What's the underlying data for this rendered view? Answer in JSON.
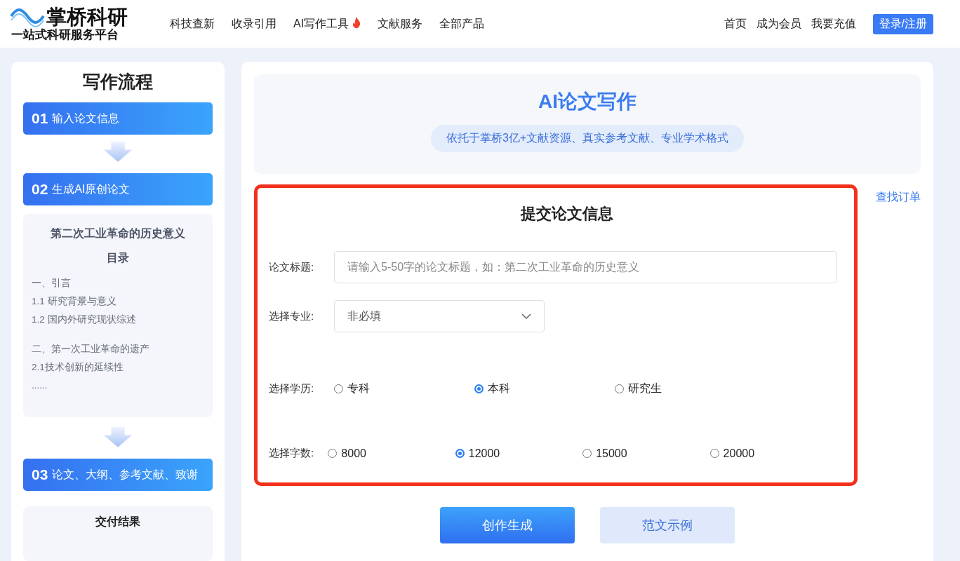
{
  "header": {
    "logo_title": "掌桥科研",
    "logo_subtitle": "一站式科研服务平台",
    "nav": [
      {
        "label": "科技查新",
        "hot": false
      },
      {
        "label": "收录引用",
        "hot": false
      },
      {
        "label": "AI写作工具",
        "hot": true
      },
      {
        "label": "文献服务",
        "hot": false
      },
      {
        "label": "全部产品",
        "hot": false
      }
    ],
    "links": [
      "首页",
      "成为会员",
      "我要充值"
    ],
    "login": "登录/注册"
  },
  "sidebar": {
    "title": "写作流程",
    "steps": [
      {
        "number": "01",
        "label": "输入论文信息"
      },
      {
        "number": "02",
        "label": "生成AI原创论文"
      },
      {
        "number": "03",
        "label": "论文、大纲、参考文献、致谢"
      }
    ],
    "outline": {
      "title": "第二次工业革命的历史意义",
      "subtitle": "目录",
      "sections": [
        [
          "一、引言",
          "1.1 研究背景与意义",
          "1.2 国内外研究现状综述"
        ],
        [
          "二、第一次工业革命的遗产",
          "2.1技术创新的延续性",
          "......"
        ]
      ]
    },
    "delivery": {
      "title": "交付结果"
    }
  },
  "hero": {
    "title": "AI论文写作",
    "subtitle": "依托于掌桥3亿+文献资源、真实参考文献、专业学术格式"
  },
  "find_order": "查找订单",
  "form": {
    "title": "提交论文信息",
    "title_field": {
      "label": "论文标题:",
      "placeholder": "请输入5-50字的论文标题，如：第二次工业革命的历史意义"
    },
    "major_field": {
      "label": "选择专业:",
      "value": "非必填"
    },
    "radio_groups": [
      {
        "label": "选择学历:",
        "options": [
          {
            "label": "专科",
            "selected": false
          },
          {
            "label": "本科",
            "selected": true
          },
          {
            "label": "研究生",
            "selected": false
          }
        ]
      },
      {
        "label": "选择字数:",
        "options": [
          {
            "label": "8000",
            "selected": false
          },
          {
            "label": "12000",
            "selected": true
          },
          {
            "label": "15000",
            "selected": false
          },
          {
            "label": "20000",
            "selected": false
          }
        ]
      }
    ]
  },
  "buttons": [
    {
      "label": "创作生成",
      "kind": "primary"
    },
    {
      "label": "范文示例",
      "kind": "secondary"
    }
  ]
}
